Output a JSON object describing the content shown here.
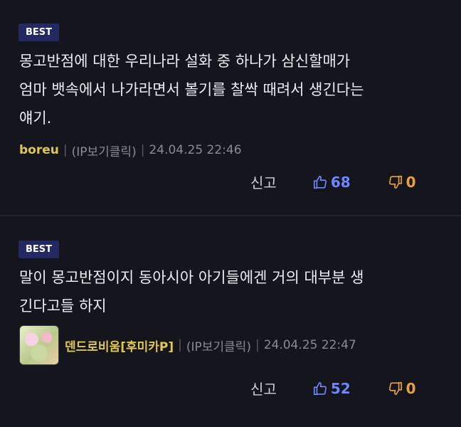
{
  "comments": [
    {
      "badge": "BEST",
      "text": "몽고반점에 대한 우리나라 설화 중 하나가 삼신할매가\n엄마 뱃속에서 나가라면서 볼기를 찰싹 때려서 생긴다는\n얘기.",
      "author": "boreu",
      "ip": "(IP보기클릭)",
      "date": "24.04.25 22:46",
      "report_label": "신고",
      "upvotes": "68",
      "downvotes": "0"
    },
    {
      "badge": "BEST",
      "text": "말이 몽고반점이지 동아시아 아기들에겐 거의 대부분 생\n긴다고들 하지",
      "author": "덴드로비움[후미카P]",
      "ip": "(IP보기클릭)",
      "date": "24.04.25 22:47",
      "report_label": "신고",
      "upvotes": "52",
      "downvotes": "0"
    }
  ],
  "colors": {
    "background": "#15151e",
    "badge": "#232a63",
    "author": "#e0c850",
    "upvote": "#6f86ff",
    "downvote": "#e8a040"
  },
  "icons": {
    "upvote": "thumbs-up-icon",
    "downvote": "thumbs-down-icon"
  }
}
